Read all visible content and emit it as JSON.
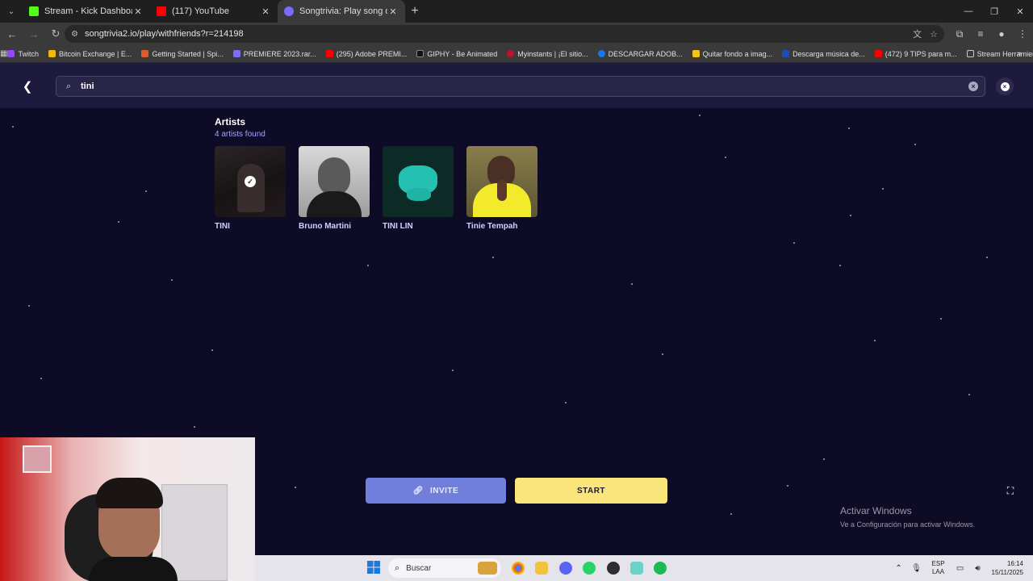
{
  "browser": {
    "tabs": [
      {
        "title": "Stream - Kick Dashboard",
        "color": "#53fc18"
      },
      {
        "title": "(117) YouTube",
        "color": "#ff0000"
      },
      {
        "title": "Songtrivia: Play song quizzes w",
        "color": "#7b6cff"
      }
    ],
    "url": "songtrivia2.io/play/withfriends?r=214198",
    "bookmarks": [
      {
        "label": "Twitch",
        "color": "#9146ff"
      },
      {
        "label": "Bitcoin Exchange | E...",
        "color": "#f0b90b"
      },
      {
        "label": "Getting Started | Spi...",
        "color": "#e05d2a"
      },
      {
        "label": "PREMIERE 2023.rar...",
        "color": "#7c6cff"
      },
      {
        "label": "(295) Adobe PREMI...",
        "color": "#ff0000"
      },
      {
        "label": "GIPHY - Be Animated",
        "color": "#111111"
      },
      {
        "label": "Myinstants | ¡El sitio...",
        "color": "#c0102a"
      },
      {
        "label": "DESCARGAR ADOB...",
        "color": "#1877f2"
      },
      {
        "label": "Quitar fondo a imag...",
        "color": "#f5c518"
      },
      {
        "label": "Descarga música de...",
        "color": "#1b4fb5"
      },
      {
        "label": "(472) 9 TIPS para m...",
        "color": "#ff0000"
      },
      {
        "label": "Stream Herramientas",
        "color": "#cccccc"
      }
    ]
  },
  "search": {
    "value": "tini"
  },
  "artists_section": {
    "title": "Artists",
    "count": "4 artists found",
    "items": [
      {
        "name": "TINI",
        "selected": true
      },
      {
        "name": "Bruno Martini",
        "selected": false
      },
      {
        "name": "TINI LIN",
        "selected": false
      },
      {
        "name": "Tinie Tempah",
        "selected": false
      }
    ]
  },
  "actions": {
    "invite_label": "INVITE",
    "start_label": "START"
  },
  "watermark": {
    "line1": "Activar Windows",
    "line2": "Ve a Configuración para activar Windows."
  },
  "taskbar": {
    "search_placeholder": "Buscar",
    "lang_top": "ESP",
    "lang_bottom": "LAA",
    "time": "16:14",
    "date": "15/11/2025"
  },
  "colors": {
    "accent": "#6f7fdb",
    "start": "#f9e57a",
    "background": "#0e0b26",
    "navbar": "#1e1a3e"
  }
}
